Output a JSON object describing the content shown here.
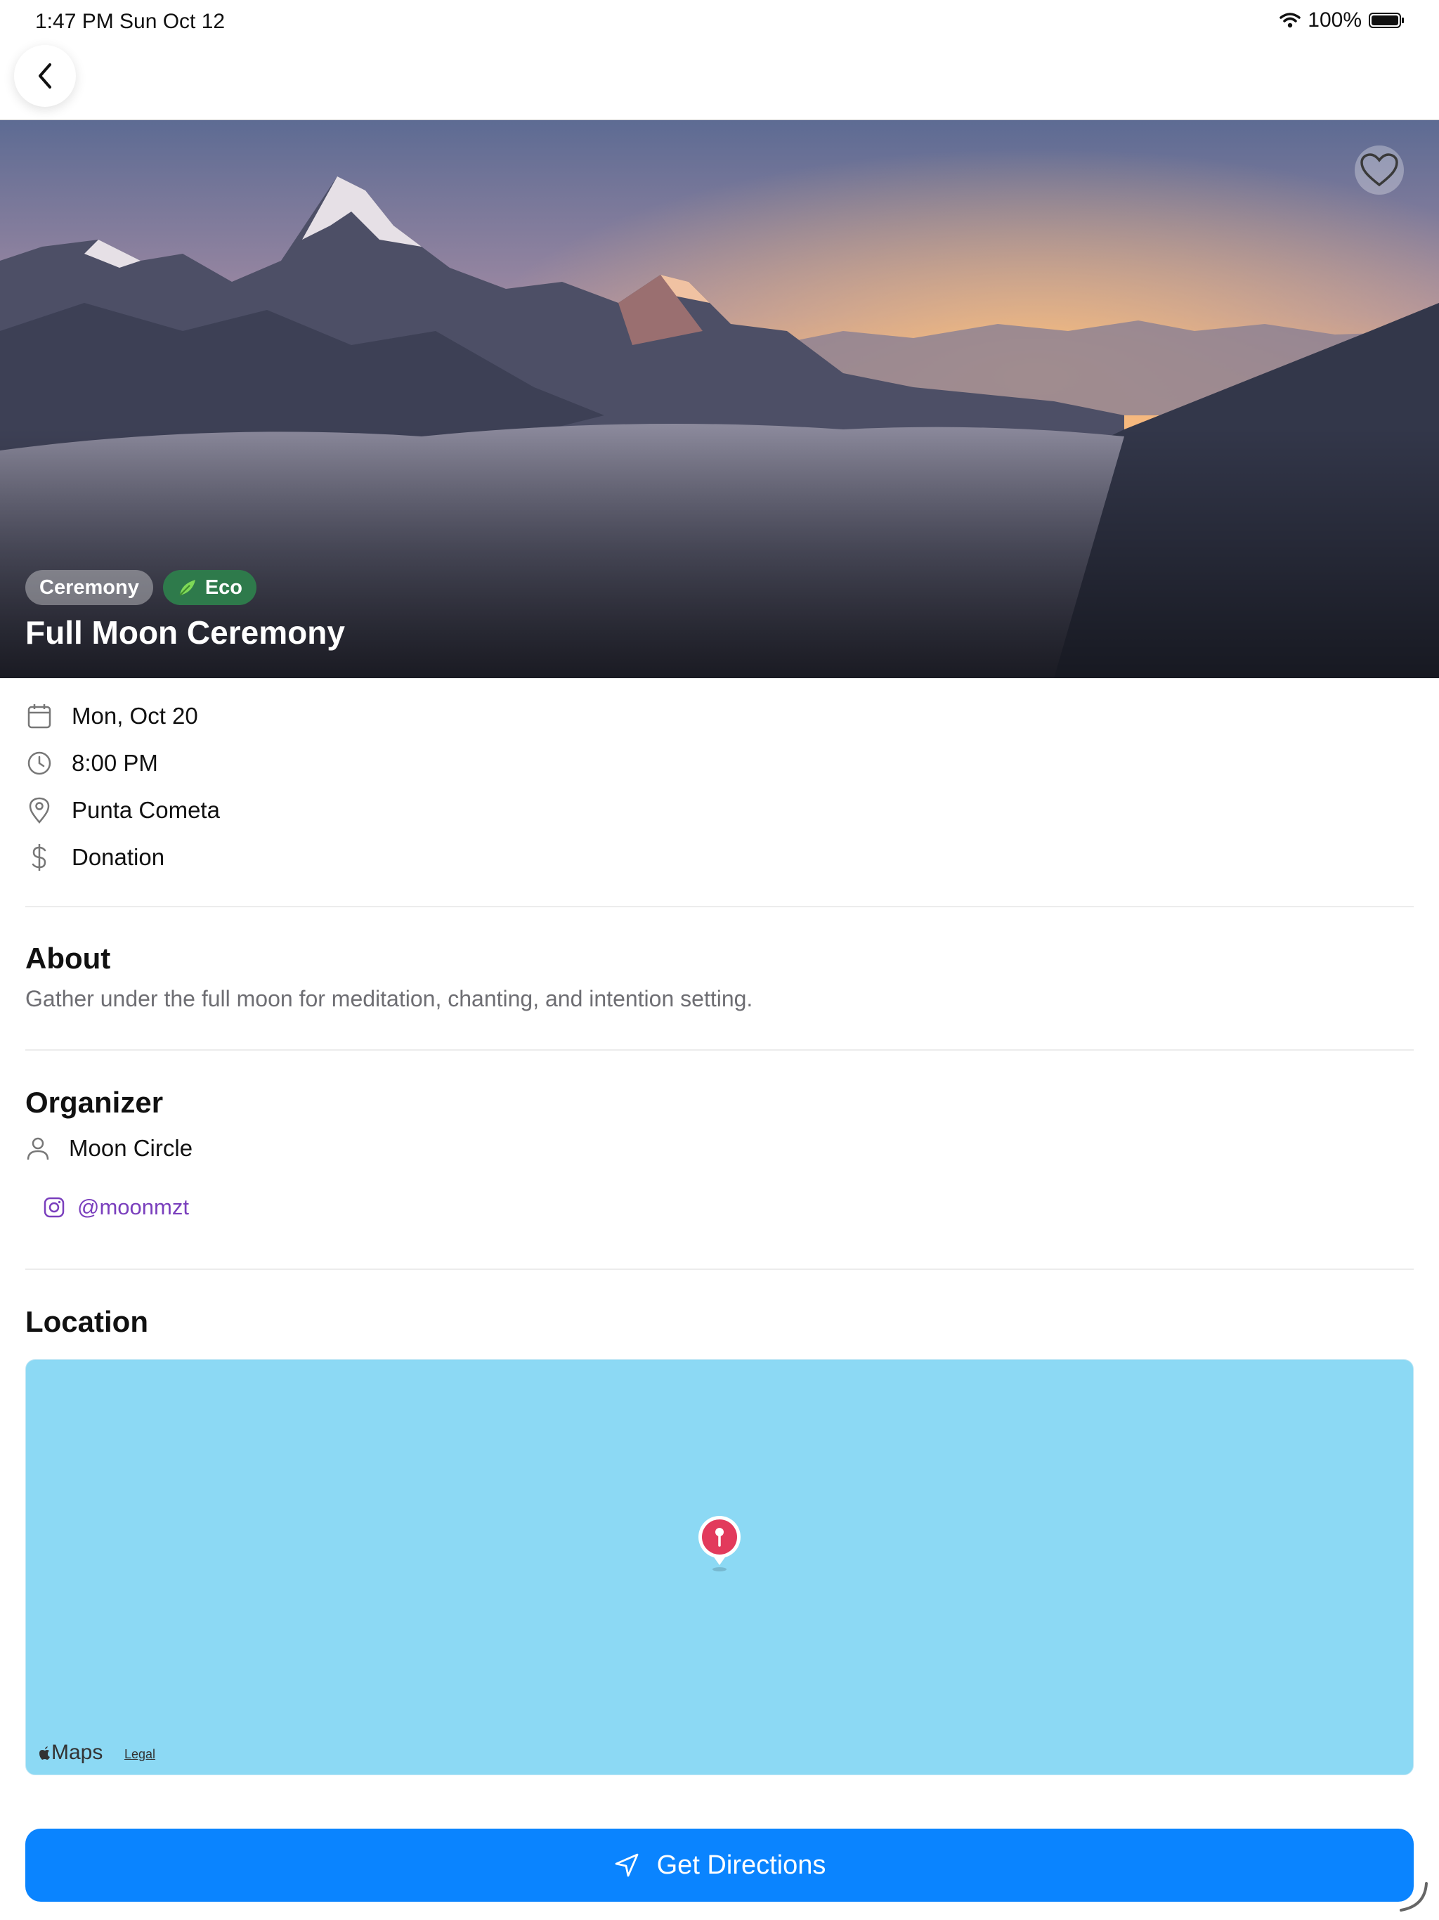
{
  "status_bar": {
    "time": "1:47 PM",
    "date": "Sun Oct 12",
    "battery": "100%"
  },
  "nav": {
    "back_icon": "chevron-left-icon"
  },
  "hero": {
    "tags": [
      {
        "label": "Ceremony"
      },
      {
        "label": "Eco",
        "icon": "leaf-icon",
        "color": "#2e7a4b"
      }
    ],
    "title": "Full Moon Ceremony",
    "favorite_icon": "heart-icon"
  },
  "details": {
    "date": "Mon, Oct 20",
    "time": "8:00 PM",
    "place": "Punta Cometa",
    "price": "Donation"
  },
  "about": {
    "heading": "About",
    "text": "Gather under the full moon for meditation, chanting, and intention setting."
  },
  "organizer": {
    "heading": "Organizer",
    "name": "Moon Circle",
    "instagram": "@moonmzt",
    "instagram_color": "#7a3fbd"
  },
  "location": {
    "heading": "Location",
    "map_brand": "Maps",
    "map_legal": "Legal",
    "map_color": "#8cd9f4",
    "pin_color": "#e23a5c"
  },
  "actions": {
    "directions_label": "Get Directions",
    "accent": "#0a84ff"
  }
}
